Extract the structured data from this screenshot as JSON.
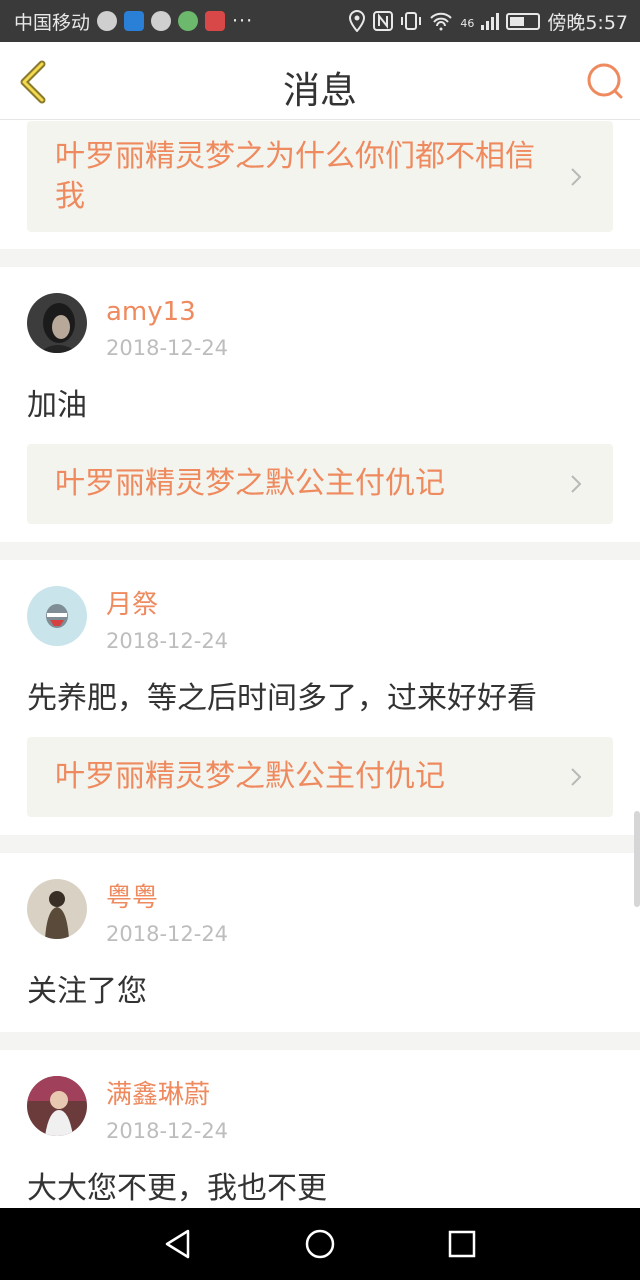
{
  "status_bar": {
    "carrier": "中国移动",
    "more": "···",
    "network": "46",
    "time": "傍晚5:57"
  },
  "header": {
    "title": "消息"
  },
  "items": [
    {
      "link": "叶罗丽精灵梦之为什么你们都不相信我"
    },
    {
      "user": "amy13",
      "date": "2018-12-24",
      "text": "加油",
      "link": "叶罗丽精灵梦之默公主付仇记"
    },
    {
      "user": "月祭",
      "date": "2018-12-24",
      "text": "先养肥，等之后时间多了，过来好好看",
      "link": "叶罗丽精灵梦之默公主付仇记"
    },
    {
      "user": "粤粤",
      "date": "2018-12-24",
      "text": "关注了您"
    },
    {
      "user": "满鑫琳蔚",
      "date": "2018-12-24",
      "text": "大大您不更，我也不更"
    }
  ],
  "colors": {
    "accent": "#ee8a5e",
    "text": "#333333",
    "date": "#bdbdbd",
    "card_bg": "#f4f4ef"
  }
}
